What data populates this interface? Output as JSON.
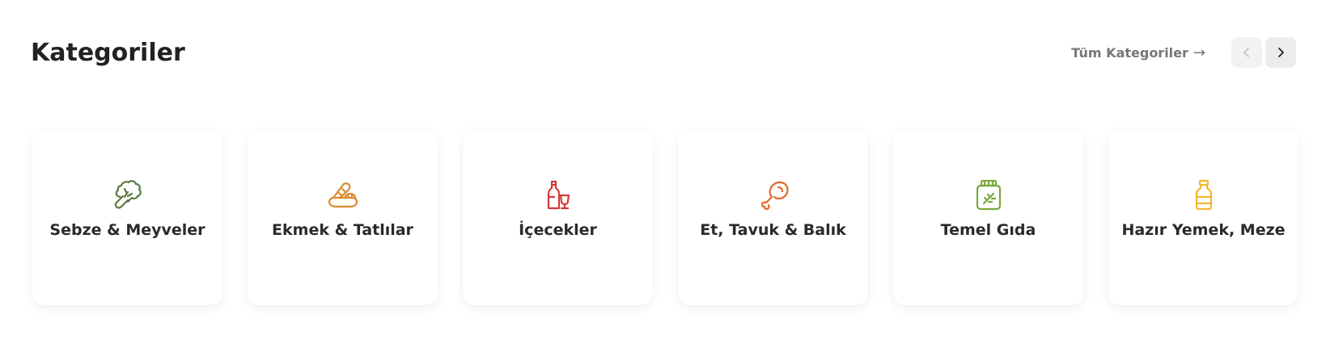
{
  "header": {
    "title": "Kategoriler",
    "all_link": "Tüm Kategoriler",
    "all_link_arrow": "→",
    "prev_label": "‹",
    "next_label": "›"
  },
  "categories": [
    {
      "label": "Sebze & Meyveler",
      "icon": "broccoli-icon",
      "color": "#5a7a44"
    },
    {
      "label": "Ekmek & Tatlılar",
      "icon": "bread-icon",
      "color": "#d98b2b"
    },
    {
      "label": "İçecekler",
      "icon": "wine-bottle-glass-icon",
      "color": "#d23a3a"
    },
    {
      "label": "Et, Tavuk & Balık",
      "icon": "chicken-leg-icon",
      "color": "#e06a2a"
    },
    {
      "label": "Temel Gıda",
      "icon": "jar-icon",
      "color": "#7aa83a"
    },
    {
      "label": "Hazır Yemek, Meze",
      "icon": "sauce-bottle-icon",
      "color": "#f2b632"
    }
  ]
}
